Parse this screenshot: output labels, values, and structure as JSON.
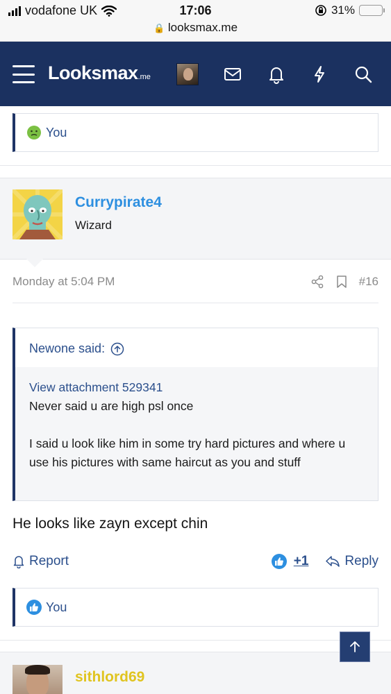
{
  "status_bar": {
    "carrier": "vodafone UK",
    "time": "17:06",
    "battery": "31%",
    "battery_level": 0.31,
    "url": "looksmax.me"
  },
  "header": {
    "logo_main": "Looksmax",
    "logo_suffix": ".me",
    "icons": [
      "menu-icon",
      "avatar",
      "mail-icon",
      "bell-icon",
      "lightning-icon",
      "search-icon"
    ],
    "bg_color": "#1b3160"
  },
  "prev_reaction": {
    "label": "You",
    "icon": "sick-face-emoji-icon"
  },
  "post": {
    "username": "Currypirate4",
    "user_title": "Wizard",
    "username_color": "#2d8fe0",
    "date": "Monday at 5:04 PM",
    "number": "#16",
    "quote": {
      "title": "Newone said:",
      "attachment_link": "View attachment 529341",
      "line1": "Never said u are high psl once",
      "line2": "I said u look like him in some try hard pictures and where u use his pictures with same haircut as you and stuff"
    },
    "text": "He looks like zayn except chin",
    "report_label": "Report",
    "like_count": "+1",
    "reply_label": "Reply",
    "reaction": {
      "label": "You",
      "icon": "thumbs-up-icon"
    }
  },
  "next_post": {
    "username": "sithlord69",
    "username_color": "#e0c420"
  }
}
